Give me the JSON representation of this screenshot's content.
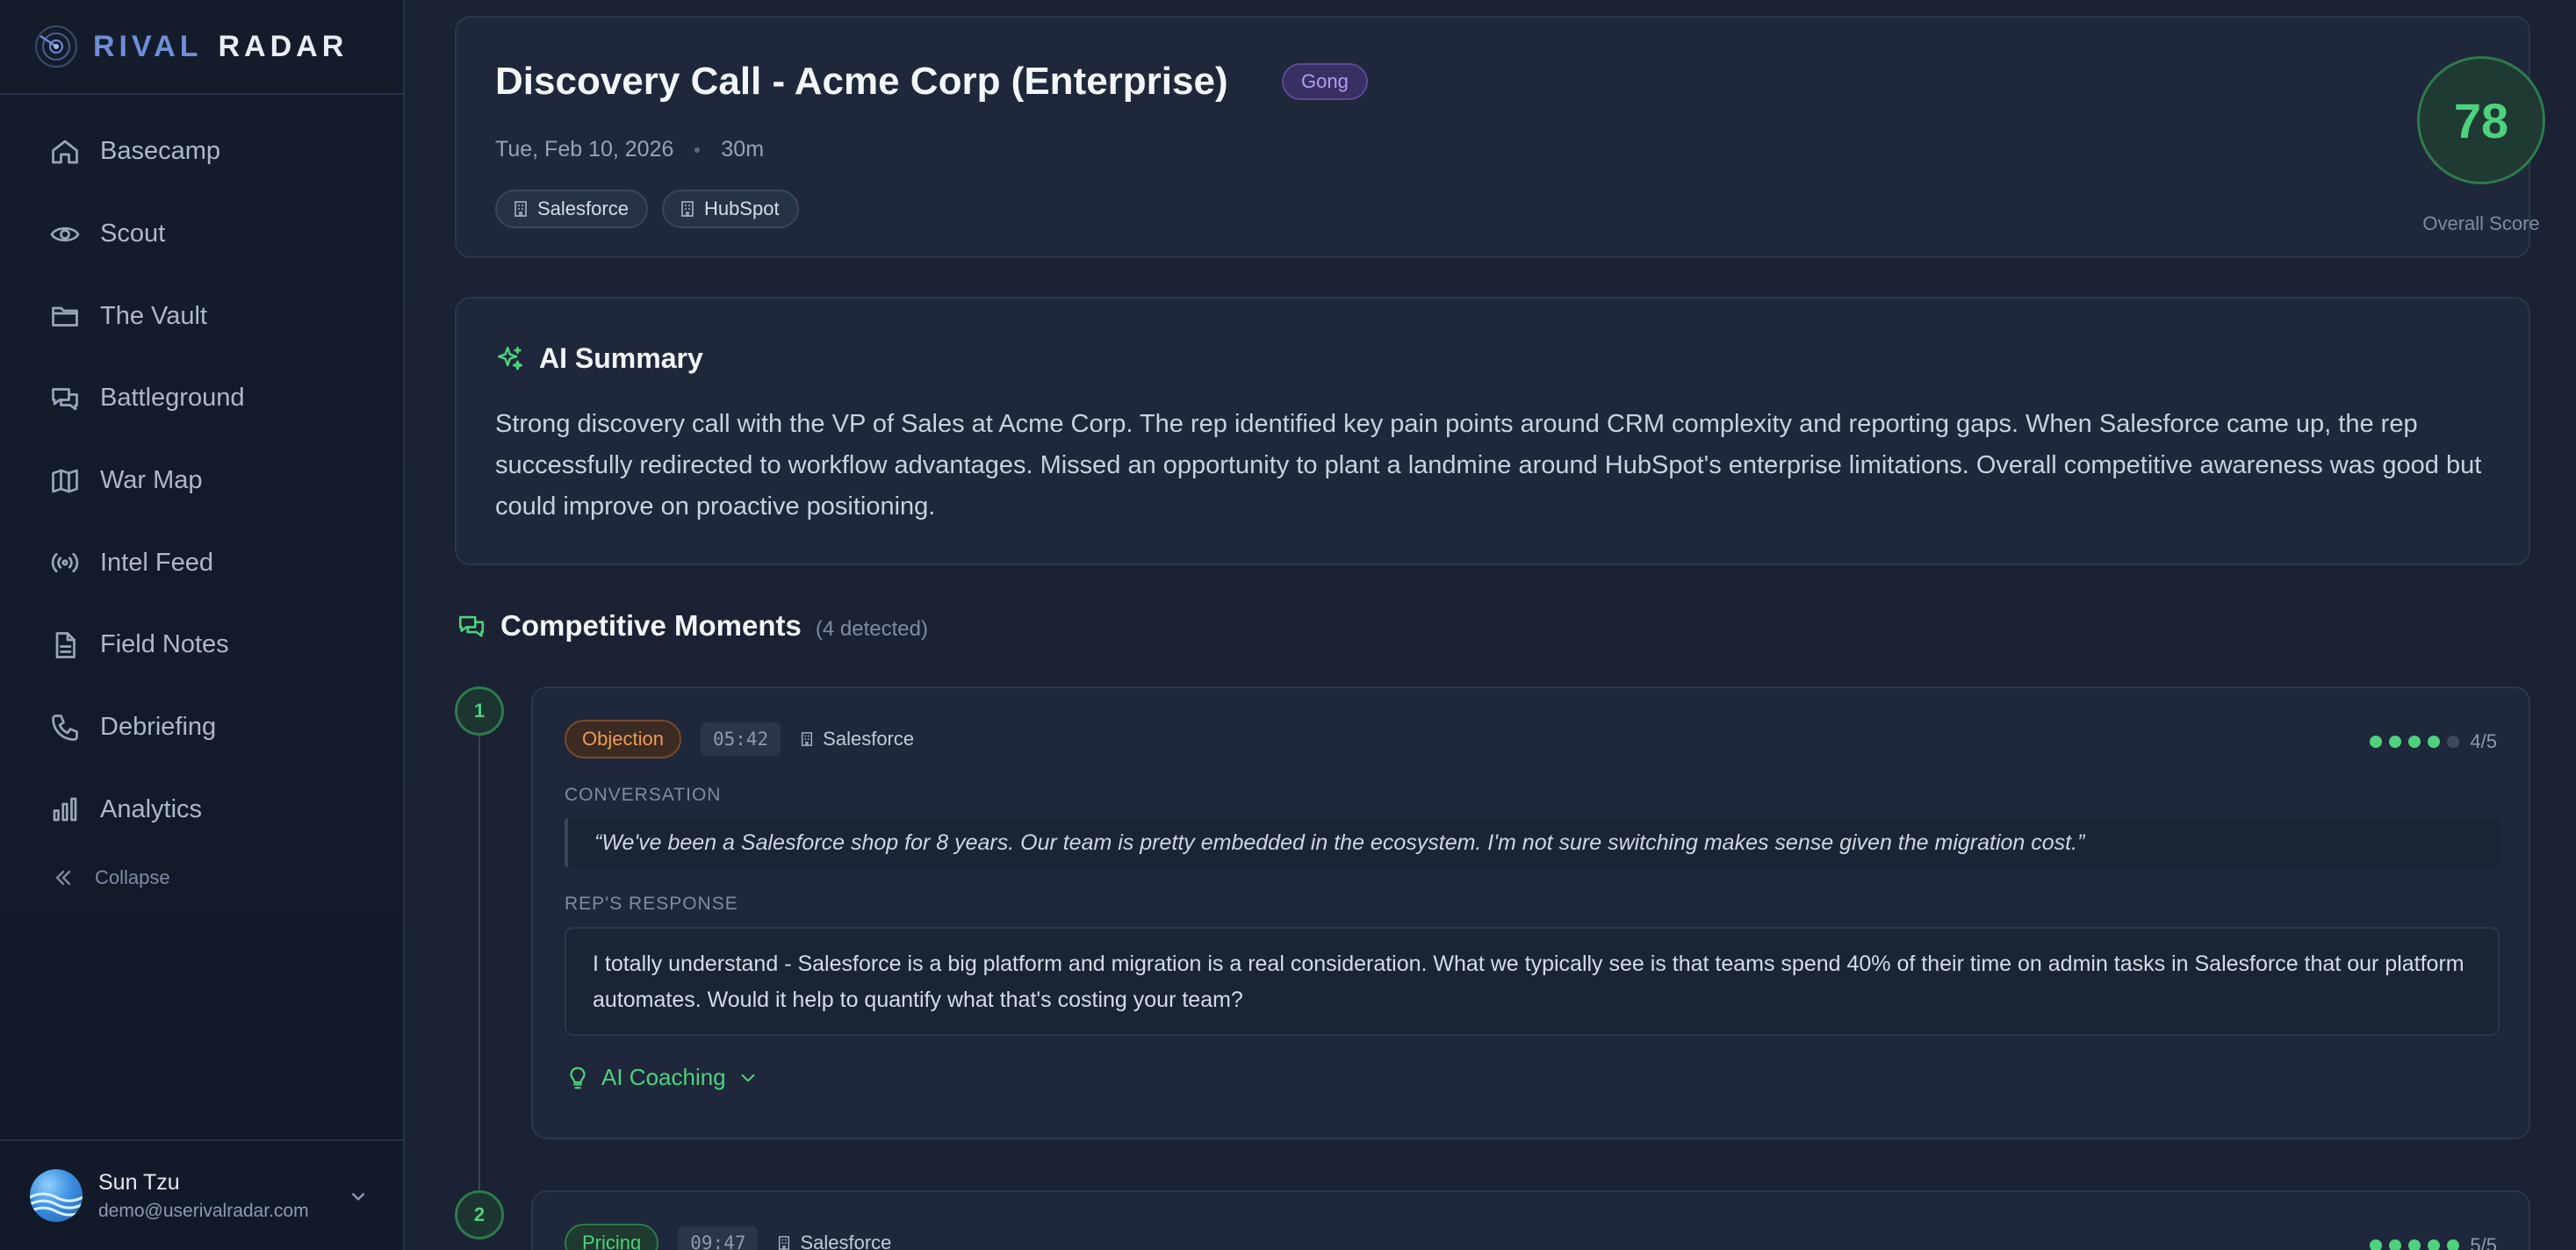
{
  "brand": {
    "word1": "RIVAL",
    "word2": "RADAR"
  },
  "sidebar": {
    "items": [
      {
        "label": "Basecamp",
        "icon": "home-icon"
      },
      {
        "label": "Scout",
        "icon": "eye-icon"
      },
      {
        "label": "The Vault",
        "icon": "folder-icon"
      },
      {
        "label": "Battleground",
        "icon": "chat-bubbles-icon"
      },
      {
        "label": "War Map",
        "icon": "map-icon"
      },
      {
        "label": "Intel Feed",
        "icon": "broadcast-icon"
      },
      {
        "label": "Field Notes",
        "icon": "document-icon"
      },
      {
        "label": "Debriefing",
        "icon": "phone-icon"
      },
      {
        "label": "Analytics",
        "icon": "bar-chart-icon"
      }
    ],
    "collapse_label": "Collapse"
  },
  "user": {
    "name": "Sun Tzu",
    "email": "demo@userivalradar.com"
  },
  "call": {
    "title": "Discovery Call - Acme Corp (Enterprise)",
    "source_badge": "Gong",
    "date": "Tue, Feb 10, 2026",
    "duration": "30m",
    "competitors": [
      "Salesforce",
      "HubSpot"
    ],
    "score": "78",
    "score_label": "Overall Score"
  },
  "summary": {
    "title": "AI Summary",
    "text": "Strong discovery call with the VP of Sales at Acme Corp. The rep identified key pain points around CRM complexity and reporting gaps. When Salesforce came up, the rep successfully redirected to workflow advantages. Missed an opportunity to plant a landmine around HubSpot's enterprise limitations. Overall competitive awareness was good but could improve on proactive positioning."
  },
  "moments": {
    "title": "Competitive Moments",
    "count": "(4 detected)",
    "items": [
      {
        "number": "1",
        "type": "Objection",
        "time": "05:42",
        "competitor": "Salesforce",
        "rating": 4,
        "rating_text": "4/5",
        "conversation_label": "CONVERSATION",
        "quote": "“We've been a Salesforce shop for 8 years. Our team is pretty embedded in the ecosystem. I'm not sure switching makes sense given the migration cost.”",
        "response_label": "REP'S RESPONSE",
        "response": "I totally understand - Salesforce is a big platform and migration is a real consideration. What we typically see is that teams spend 40% of their time on admin tasks in Salesforce that our platform automates. Would it help to quantify what that's costing your team?",
        "coaching_label": "AI Coaching"
      },
      {
        "number": "2",
        "type": "Pricing",
        "time": "09:47",
        "competitor": "Salesforce",
        "rating": 5,
        "rating_text": "5/5"
      }
    ]
  },
  "colors": {
    "accent": "#4fd17d",
    "objection": "#f09a52",
    "gong": "#b49cf2",
    "background": "#1a2233"
  }
}
